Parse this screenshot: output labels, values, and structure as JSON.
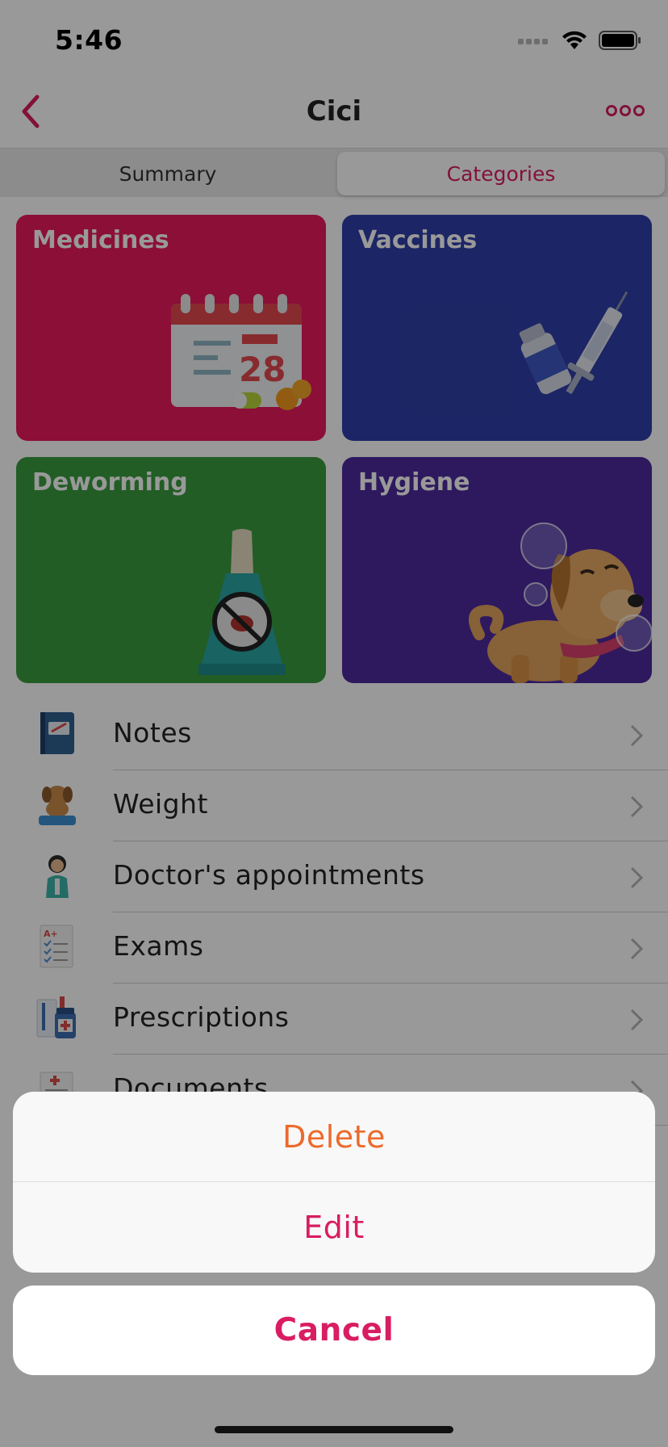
{
  "status_bar": {
    "time": "5:46"
  },
  "nav": {
    "title": "Cici"
  },
  "segments": {
    "summary": "Summary",
    "categories": "Categories",
    "selected": "Categories"
  },
  "categories": [
    {
      "label": "Medicines",
      "color": "#e8195c"
    },
    {
      "label": "Vaccines",
      "color": "#2f3fa8"
    },
    {
      "label": "Deworming",
      "color": "#3a9b3e"
    },
    {
      "label": "Hygiene",
      "color": "#4d2a9e"
    }
  ],
  "calendar_day": "28",
  "list": [
    {
      "label": "Notes",
      "icon": "notebook-icon"
    },
    {
      "label": "Weight",
      "icon": "dog-on-scale-icon"
    },
    {
      "label": "Doctor's appointments",
      "icon": "doctor-icon"
    },
    {
      "label": "Exams",
      "icon": "exam-sheet-icon"
    },
    {
      "label": "Prescriptions",
      "icon": "prescription-icon"
    },
    {
      "label": "Documents",
      "icon": "document-icon"
    }
  ],
  "action_sheet": {
    "delete_label": "Delete",
    "edit_label": "Edit",
    "cancel_label": "Cancel"
  },
  "colors": {
    "accent": "#d91d62",
    "destructive": "#ec6a2c"
  }
}
